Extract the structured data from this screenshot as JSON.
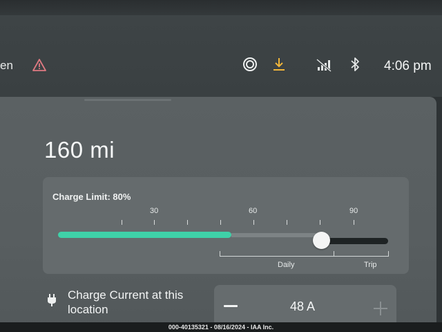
{
  "status_bar": {
    "left_text": "en",
    "clock": "4:06 pm",
    "icons": [
      "warning-icon",
      "target-icon",
      "download-icon",
      "no-signal-icon",
      "bluetooth-icon"
    ],
    "colors": {
      "warning": "#e07a82",
      "download": "#f0b53a"
    }
  },
  "charging": {
    "range": "160 mi",
    "charge_limit_label": "Charge Limit: 80%",
    "charge_limit_percent": 80,
    "current_charge_percent": 52,
    "scale_labels": [
      "30",
      "60",
      "90"
    ],
    "zones": {
      "daily": "Daily",
      "trip": "Trip"
    },
    "accent_color": "#3fd1a8",
    "current_label": "Charge Current at this location",
    "current_value": "48 A"
  },
  "watermark": "000-40135321 - 08/16/2024 - IAA Inc."
}
